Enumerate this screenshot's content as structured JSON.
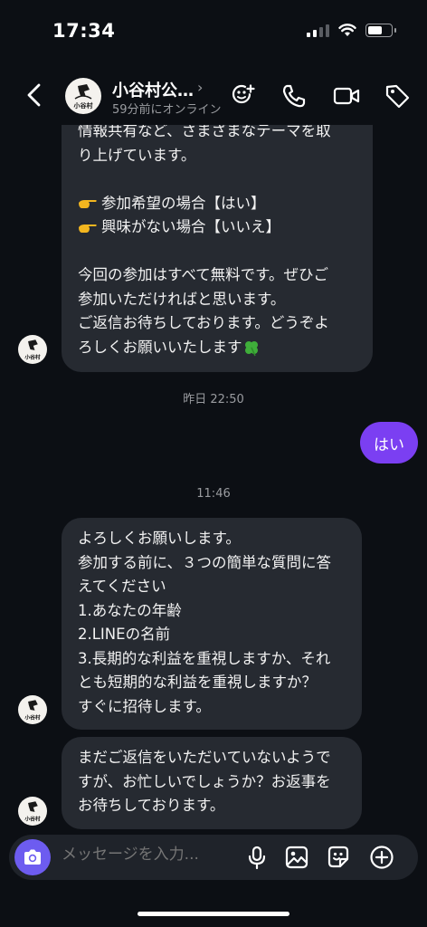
{
  "status_bar": {
    "time": "17:34"
  },
  "header": {
    "title": "小谷村公…",
    "subtitle": "59分前にオンライン",
    "chevron": "›"
  },
  "messages": {
    "first": {
      "lines": [
        "情報共有など、さまざまなテーマを取",
        "り上げています。"
      ],
      "option_yes": "参加希望の場合【はい】",
      "option_no": "興味がない場合【いいえ】",
      "closing": [
        "今回の参加はすべて無料です。ぜひご",
        "参加いただければと思います。",
        "ご返信お待ちしております。どうぞよ",
        "ろしくお願いいたします"
      ]
    },
    "timestamp_1": "昨日 22:50",
    "sent_reply": "はい",
    "timestamp_2": "11:46",
    "second": {
      "lines": [
        "よろしくお願いします。",
        "参加する前に、３つの簡単な質問に答",
        "えてください",
        "1.あなたの年齢",
        "2.LINEの名前",
        "3.長期的な利益を重視しますか、それ",
        "とも短期的な利益を重視しますか？",
        "すぐに招待します。"
      ]
    },
    "third": {
      "lines": [
        "まだご返信をいただいていないようで",
        "すが、お忙しいでしょうか？お返事を",
        "お待ちしております。"
      ]
    }
  },
  "avatar_text": "小谷村",
  "composer": {
    "placeholder": "メッセージを入力..."
  },
  "colors": {
    "background": "#0c0f14",
    "bubble": "#262a31",
    "sent": "#7b3ff2",
    "camera": "#6d5cf0"
  },
  "icons": [
    "back-icon",
    "add-member-icon",
    "phone-icon",
    "video-icon",
    "tag-icon",
    "camera-icon",
    "mic-icon",
    "gallery-icon",
    "sticker-icon",
    "plus-icon"
  ]
}
